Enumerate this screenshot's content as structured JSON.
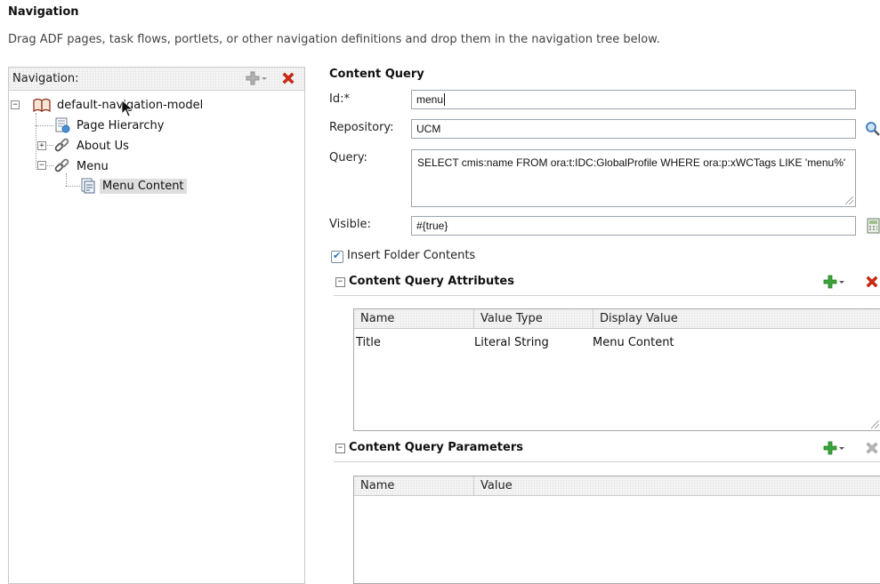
{
  "page": {
    "title": "Navigation",
    "description": "Drag ADF pages, task flows, portlets, or other navigation definitions and drop them in the navigation tree below."
  },
  "nav_panel": {
    "header_label": "Navigation:",
    "tree": [
      {
        "label": "default-navigation-model",
        "icon": "book-icon",
        "expander": "−"
      },
      {
        "label": "Page Hierarchy",
        "icon": "page-hierarchy-icon"
      },
      {
        "label": "About Us",
        "icon": "link-icon",
        "expander": "+"
      },
      {
        "label": "Menu",
        "icon": "link-icon",
        "expander": "−"
      },
      {
        "label": "Menu Content",
        "icon": "content-query-icon",
        "selected": true
      }
    ]
  },
  "form": {
    "section_title": "Content Query",
    "id_label": "Id:*",
    "id_value": "menu",
    "repository_label": "Repository:",
    "repository_value": "UCM",
    "query_label": "Query:",
    "query_value": "SELECT cmis:name FROM ora:t:IDC:GlobalProfile WHERE ora:p:xWCTags LIKE 'menu%'",
    "visible_label": "Visible:",
    "visible_value": "#{true}",
    "insert_folder_label": "Insert Folder Contents",
    "insert_folder_checked": true
  },
  "attributes": {
    "title": "Content Query Attributes",
    "columns": [
      "Name",
      "Value Type",
      "Display Value"
    ],
    "rows": [
      {
        "name": "Title",
        "value_type": "Literal String",
        "display_value": "Menu Content"
      }
    ]
  },
  "parameters": {
    "title": "Content Query Parameters",
    "columns": [
      "Name",
      "Value"
    ],
    "rows": []
  },
  "colors": {
    "add_green": "#3aa53a",
    "delete_red": "#d42a12",
    "disabled_gray": "#9a9a9a"
  }
}
